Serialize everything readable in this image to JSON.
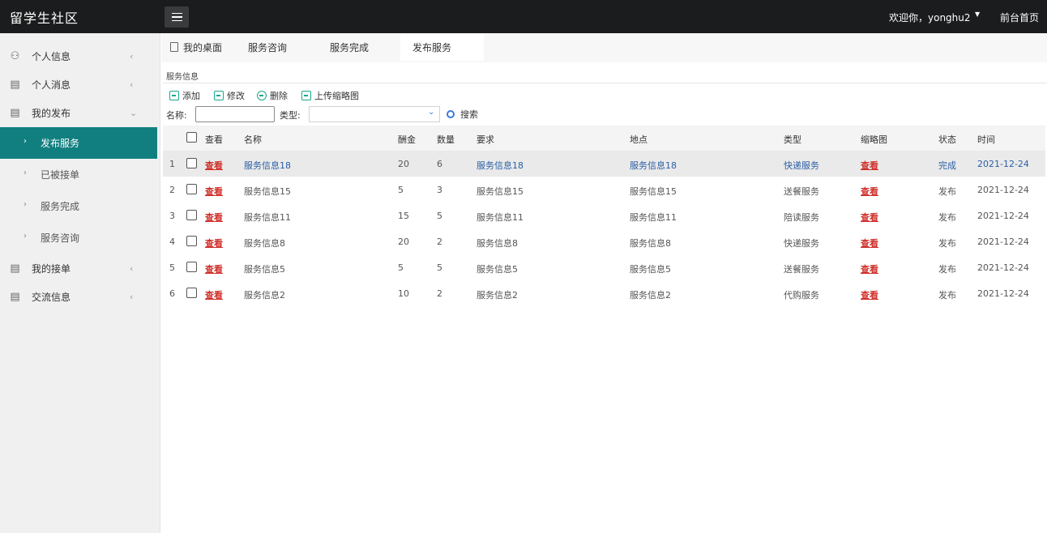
{
  "app": {
    "title": "留学生社区",
    "welcome": "欢迎你，yonghu2",
    "front_home": "前台首页"
  },
  "sidebar": {
    "items": [
      {
        "label": "个人信息"
      },
      {
        "label": "个人消息"
      },
      {
        "label": "我的发布"
      },
      {
        "label": "我的接单"
      },
      {
        "label": "交流信息"
      }
    ],
    "sub_items": [
      {
        "label": "发布服务"
      },
      {
        "label": "已被接单"
      },
      {
        "label": "服务完成"
      },
      {
        "label": "服务咨询"
      }
    ]
  },
  "tabs": [
    {
      "label": "我的桌面"
    },
    {
      "label": "服务咨询"
    },
    {
      "label": "服务完成"
    },
    {
      "label": "发布服务"
    }
  ],
  "panel": {
    "title": "服务信息",
    "toolbar": {
      "add": "添加",
      "edit": "修改",
      "delete": "删除",
      "upload": "上传缩略图"
    },
    "filter": {
      "name_label": "名称:",
      "name_value": "",
      "type_label": "类型:",
      "type_value": "",
      "search": "搜索"
    }
  },
  "table": {
    "headers": {
      "view": "查看",
      "name": "名称",
      "reward": "酬金",
      "qty": "数量",
      "req": "要求",
      "place": "地点",
      "type": "类型",
      "thumb": "缩略图",
      "status": "状态",
      "time": "时间"
    },
    "rows": [
      {
        "idx": "1",
        "view": "查看",
        "name": "服务信息18",
        "reward": "20",
        "qty": "6",
        "req": "服务信息18",
        "place": "服务信息18",
        "type": "快递服务",
        "thumb": "查看",
        "status": "完成",
        "time": "2021-12-24"
      },
      {
        "idx": "2",
        "view": "查看",
        "name": "服务信息15",
        "reward": "5",
        "qty": "3",
        "req": "服务信息15",
        "place": "服务信息15",
        "type": "送餐服务",
        "thumb": "查看",
        "status": "发布",
        "time": "2021-12-24"
      },
      {
        "idx": "3",
        "view": "查看",
        "name": "服务信息11",
        "reward": "15",
        "qty": "5",
        "req": "服务信息11",
        "place": "服务信息11",
        "type": "陪读服务",
        "thumb": "查看",
        "status": "发布",
        "time": "2021-12-24"
      },
      {
        "idx": "4",
        "view": "查看",
        "name": "服务信息8",
        "reward": "20",
        "qty": "2",
        "req": "服务信息8",
        "place": "服务信息8",
        "type": "快递服务",
        "thumb": "查看",
        "status": "发布",
        "time": "2021-12-24"
      },
      {
        "idx": "5",
        "view": "查看",
        "name": "服务信息5",
        "reward": "5",
        "qty": "5",
        "req": "服务信息5",
        "place": "服务信息5",
        "type": "送餐服务",
        "thumb": "查看",
        "status": "发布",
        "time": "2021-12-24"
      },
      {
        "idx": "6",
        "view": "查看",
        "name": "服务信息2",
        "reward": "10",
        "qty": "2",
        "req": "服务信息2",
        "place": "服务信息2",
        "type": "代购服务",
        "thumb": "查看",
        "status": "发布",
        "time": "2021-12-24"
      }
    ]
  },
  "colors": {
    "topbar": "#1b1c1d",
    "active_nav": "#117f80",
    "link_red": "#d0302a",
    "link_blue": "#2a5fa5"
  }
}
